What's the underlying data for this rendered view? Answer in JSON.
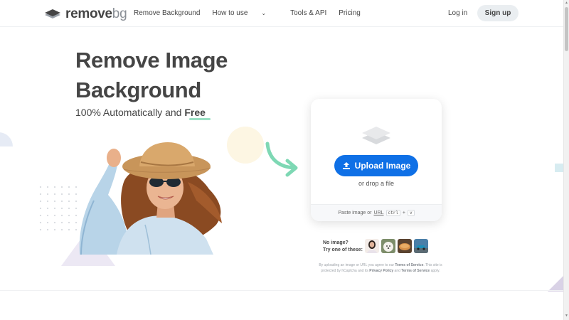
{
  "header": {
    "logo_text": "remove",
    "logo_suffix": "bg",
    "nav": [
      {
        "label": "Remove Background"
      },
      {
        "label": "How to use",
        "has_dropdown": true
      },
      {
        "label": "Tools & API"
      },
      {
        "label": "Pricing"
      }
    ],
    "login_label": "Log in",
    "signup_label": "Sign up"
  },
  "hero": {
    "title_line1": "Remove Image",
    "title_line2": "Background",
    "subtitle_prefix": "100% Automatically and ",
    "subtitle_emphasis": "Free"
  },
  "upload": {
    "button_label": "Upload Image",
    "drop_text": "or drop a file",
    "paste_prefix": "Paste image or",
    "paste_url": "URL",
    "shortcut_key1": "ctrl",
    "shortcut_plus": "+",
    "shortcut_key2": "v"
  },
  "samples": {
    "line1": "No image?",
    "line2": "Try one of these:"
  },
  "terms": {
    "text1": "By uploading an image or URL you agree to our",
    "tos": "Terms of Service",
    "text2": ". This site is protected by hCaptcha and its",
    "privacy": "Privacy Policy",
    "text3": "and",
    "tos2": "Terms of Service",
    "text4": "apply."
  },
  "colors": {
    "brand_blue": "#0f70e6",
    "accent_green": "#9be0c4",
    "text_dark": "#454545"
  }
}
